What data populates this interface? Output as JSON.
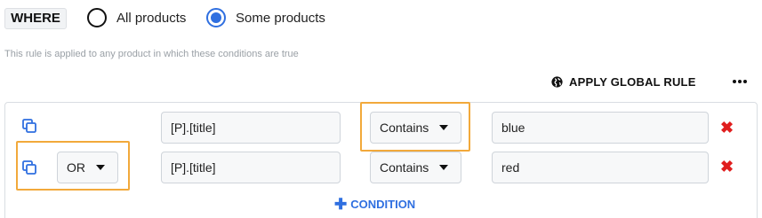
{
  "where": {
    "label": "WHERE",
    "options": [
      {
        "label": "All products",
        "selected": false
      },
      {
        "label": "Some products",
        "selected": true
      }
    ]
  },
  "hint": "This rule is applied to any product in which these conditions are true",
  "toolbar": {
    "apply_global_label": "APPLY GLOBAL RULE",
    "apply_global_icon": "globe-icon",
    "more_icon": "more-horizontal-icon"
  },
  "conditions": [
    {
      "connector": null,
      "field": "[P].[title]",
      "operator": "Contains",
      "value": "blue"
    },
    {
      "connector": "OR",
      "field": "[P].[title]",
      "operator": "Contains",
      "value": "red"
    }
  ],
  "add_condition_label": "CONDITION",
  "colors": {
    "accent": "#2f6fe0",
    "highlight": "#f2a93b",
    "danger": "#e01e1e"
  }
}
